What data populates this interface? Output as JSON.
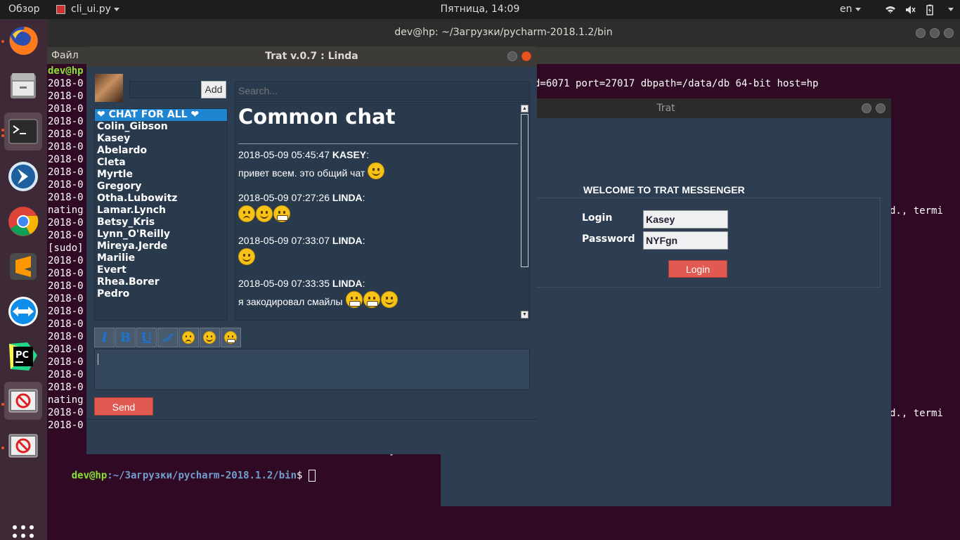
{
  "topbar": {
    "activities": "Обзор",
    "app_name": "cli_ui.py",
    "clock": "Пятница, 14:09",
    "keyboard_layout": "en"
  },
  "dock": {
    "apps": [
      "firefox-icon",
      "files-icon",
      "terminal-icon",
      "telegram-icon",
      "chrome-icon",
      "sublime-text-icon",
      "teamviewer-icon",
      "pycharm-icon",
      "trat-app-icon",
      "trat-app-icon-2"
    ],
    "show_apps": "show-applications-icon"
  },
  "terminal": {
    "title": "dev@hp: ~/Загрузки/pycharm-2018.1.2/bin",
    "menu_file": "Файл",
    "line_first": "dev@hp",
    "left_lines": [
      "2018-0",
      "2018-0",
      "2018-0",
      "2018-0",
      "2018-0",
      "2018-0",
      "2018-0",
      "2018-0",
      "2018-0",
      "2018-0",
      "nating",
      "2018-0",
      "2018-0",
      "[sudo]",
      "2018-0",
      "2018-0",
      "2018-0",
      "2018-0",
      "2018-0",
      "2018-0",
      "2018-0",
      "2018-0",
      "2018-0",
      "2018-0",
      "2018-0",
      "nating",
      "2018-0",
      "2018-0"
    ],
    "right_line_1": "d=6071 port=27017 dbpath=/data/db 64-bit host=hp",
    "right_line_2": "d., termi",
    "right_line_3": "d., termi",
    "prompt_user": "dev@hp",
    "prompt_path": ":~/Загрузки/pycharm-2018.1.2/bin",
    "prompt_symbol": "$ ",
    "bracket": "]"
  },
  "login_window": {
    "title": "Trat",
    "welcome": "WELCOME TO TRAT MESSENGER",
    "login_label": "Login",
    "login_value": "Kasey",
    "password_label": "Password",
    "password_value": "NYFgn",
    "login_button": "Login"
  },
  "chat_window": {
    "title": "Trat v.0.7 : Linda",
    "add_button": "Add",
    "search_placeholder": "Search...",
    "heading": "Common chat",
    "contacts": [
      "❤ CHAT FOR ALL ❤",
      "Colin_Gibson",
      "Kasey",
      "Abelardo",
      "Cleta",
      "Myrtle",
      "Gregory",
      "Otha.Lubowitz",
      "Lamar.Lynch",
      "Betsy_Kris",
      "Lynn_O'Reilly",
      "Mireya.Jerde",
      "Marilie",
      "Evert",
      "Rhea.Borer",
      "Pedro"
    ],
    "messages": [
      {
        "time": "2018-05-09 05:45:47",
        "author": "KASEY",
        "text": "привет всем. это общий чат",
        "smileys": [
          "happy"
        ]
      },
      {
        "time": "2018-05-09 07:27:26",
        "author": "LINDA",
        "text": "",
        "smileys": [
          "sad",
          "happy",
          "grimace"
        ]
      },
      {
        "time": "2018-05-09 07:33:07",
        "author": "LINDA",
        "text": "",
        "smileys": [
          "happy"
        ]
      },
      {
        "time": "2018-05-09 07:33:35",
        "author": "LINDA",
        "text": "я закодировал смайлы",
        "smileys": [
          "grimace",
          "grimace",
          "happy"
        ]
      }
    ],
    "toolbar": {
      "italic": "I",
      "bold": "B",
      "underline": "U",
      "brush_icon": "brush-icon",
      "smileys": [
        "sad",
        "happy",
        "grimace"
      ]
    },
    "send_button": "Send"
  }
}
